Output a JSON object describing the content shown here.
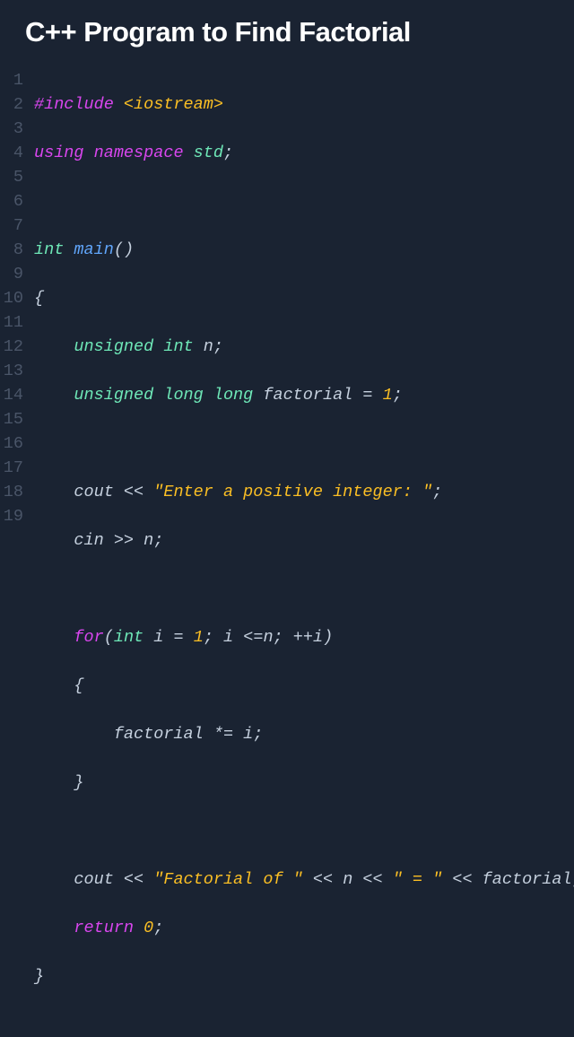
{
  "title": "C++ Program to Find Factorial",
  "gutter": [
    "1",
    "2",
    "3",
    "4",
    "5",
    "6",
    "7",
    "8",
    "9",
    "10",
    "11",
    "12",
    "13",
    "14",
    "15",
    "16",
    "17",
    "18",
    "19"
  ],
  "code": {
    "l1": {
      "a": "#include ",
      "b": "<iostream>"
    },
    "l2": {
      "a": "using ",
      "b": "namespace ",
      "c": "std",
      "d": ";"
    },
    "l3": {
      "a": ""
    },
    "l4": {
      "a": "int ",
      "b": "main",
      "c": "()"
    },
    "l5": {
      "a": "{"
    },
    "l6": {
      "a": "    ",
      "b": "unsigned int ",
      "c": "n",
      "d": ";"
    },
    "l7": {
      "a": "    ",
      "b": "unsigned long long ",
      "c": "factorial ",
      "d": "= ",
      "e": "1",
      "f": ";"
    },
    "l8": {
      "a": ""
    },
    "l9": {
      "a": "    cout ",
      "b": "<< ",
      "c": "\"Enter a positive integer: \"",
      "d": ";"
    },
    "l10": {
      "a": "    cin ",
      "b": ">> ",
      "c": "n",
      "d": ";"
    },
    "l11": {
      "a": ""
    },
    "l12": {
      "a": "    ",
      "b": "for",
      "c": "(",
      "d": "int ",
      "e": "i ",
      "f": "= ",
      "g": "1",
      "h": "; i ",
      "i": "<=",
      "j": "n; ",
      "k": "++",
      "l": "i)"
    },
    "l13": {
      "a": "    {"
    },
    "l14": {
      "a": "        factorial ",
      "b": "*= ",
      "c": "i",
      "d": ";"
    },
    "l15": {
      "a": "    }"
    },
    "l16": {
      "a": ""
    },
    "l17": {
      "a": "    cout ",
      "b": "<< ",
      "c": "\"Factorial of \"",
      "d": " << ",
      "e": "n ",
      "f": "<< ",
      "g": "\" = \"",
      "h": " << ",
      "i": "factorial",
      "j": ";"
    },
    "l18": {
      "a": "    ",
      "b": "return ",
      "c": "0",
      "d": ";"
    },
    "l19": {
      "a": "}"
    }
  }
}
